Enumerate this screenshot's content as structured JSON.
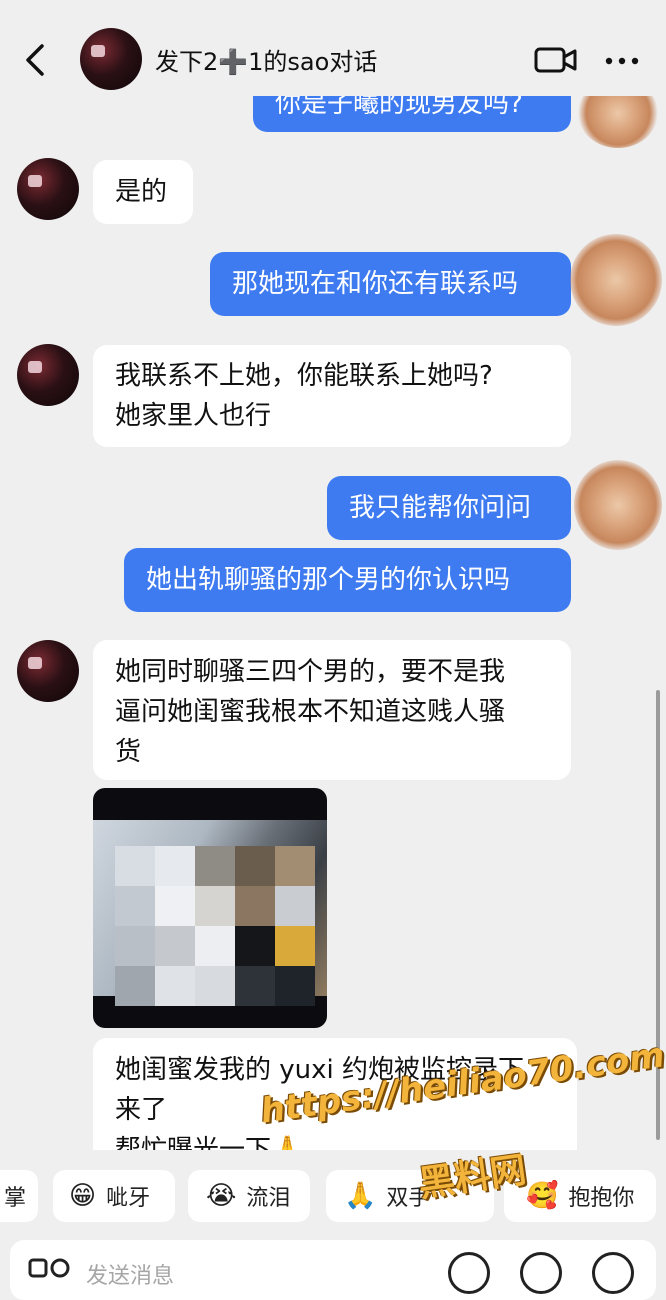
{
  "header": {
    "title": "发下2➕1的sao对话",
    "back_icon": "chevron-left-icon",
    "video_icon": "video-camera-icon",
    "more_icon": "more-dots-icon"
  },
  "messages": [
    {
      "from": "me",
      "text": "你是子曦的现男友吗?"
    },
    {
      "from": "them",
      "text": "是的"
    },
    {
      "from": "me",
      "text": "那她现在和你还有联系吗"
    },
    {
      "from": "them",
      "lines": [
        "我联系不上她，你能联系上她吗?",
        "她家里人也行"
      ]
    },
    {
      "from": "me",
      "text": "我只能帮你问问"
    },
    {
      "from": "me",
      "text": "她出轨聊骚的那个男的你认识吗"
    },
    {
      "from": "them",
      "lines": [
        "她同时聊骚三四个男的，要不是我",
        "逼问她闺蜜我根本不知道这贱人骚",
        "货"
      ]
    },
    {
      "from": "them",
      "type": "image",
      "content": "pixelated-photo"
    },
    {
      "from": "them",
      "lines": [
        "她闺蜜发我的 yuxi 约炮被监控录下",
        "来了",
        "帮忙曝光一下🙏"
      ]
    }
  ],
  "reactions": [
    {
      "emoji": "",
      "label": "掌"
    },
    {
      "emoji": "😁",
      "label": "呲牙"
    },
    {
      "emoji": "😭",
      "label": "流泪"
    },
    {
      "emoji": "🙏",
      "label": "双手"
    },
    {
      "emoji": "🥰",
      "label": "抱抱你"
    }
  ],
  "input": {
    "placeholder": "发送消息"
  },
  "watermark": {
    "url": "https://heiliao70.com",
    "name": "黑料网"
  },
  "colors": {
    "outgoing": "#3f7bf0",
    "incoming": "#ffffff",
    "background": "#efefef",
    "watermark": "#f2b43a"
  }
}
